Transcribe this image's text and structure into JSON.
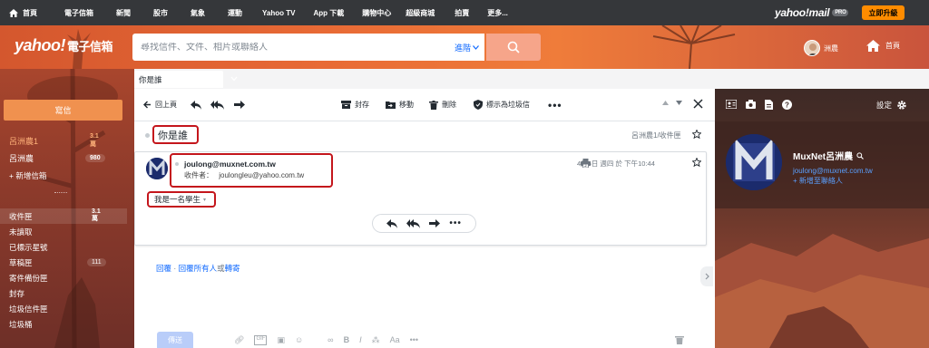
{
  "topnav": {
    "items": [
      "首頁",
      "電子信箱",
      "新聞",
      "股市",
      "氣象",
      "運動",
      "Yahoo TV",
      "App 下載",
      "購物中心",
      "超級商城",
      "拍賣",
      "更多..."
    ],
    "brand": "yahoo!mail",
    "pro_badge": "PRO",
    "upgrade_label": "立即升級"
  },
  "header": {
    "logo": "yahoo!",
    "logo_sub": "電子信箱",
    "search_placeholder": "尋找信件、文件、相片或聯絡人",
    "advanced_label": "進階",
    "user_name": "洲農",
    "home_label": "首頁"
  },
  "sidebar": {
    "compose_label": "寫信",
    "accounts": [
      {
        "name": "呂洲農1",
        "count": "3.1萬"
      },
      {
        "name": "呂洲農",
        "count": "980"
      }
    ],
    "add_mailbox": "+ 新增信箱",
    "folders": [
      {
        "name": "收件匣",
        "count": "3.1\n萬"
      },
      {
        "name": "未讀取",
        "count": ""
      },
      {
        "name": "已標示星號",
        "count": ""
      },
      {
        "name": "草稿匣",
        "count": "111"
      },
      {
        "name": "寄件備份匣",
        "count": ""
      },
      {
        "name": "封存",
        "count": ""
      },
      {
        "name": "垃圾信件匣",
        "count": ""
      },
      {
        "name": "垃圾桶",
        "count": ""
      }
    ]
  },
  "tab": {
    "label": "你是誰"
  },
  "toolbar": {
    "back_label": "回上頁",
    "archive_label": "封存",
    "move_label": "移動",
    "delete_label": "刪除",
    "spam_label": "標示為垃圾信"
  },
  "message": {
    "subject": "你是誰",
    "subject_meta": "呂洲農1/收件匣",
    "sender_email": "joulong@muxnet.com.tw",
    "to_label": "收件者：",
    "to_email": "joulongleu@yahoo.com.tw",
    "date": "4月6日 週四 於 下午10:44",
    "body": "我是一名學生",
    "body_caret": "▾"
  },
  "reply": {
    "reply": "回覆",
    "sep1": " · ",
    "reply_all": "回覆所有人",
    "or": "或",
    "forward": "轉寄",
    "send_label": "傳送"
  },
  "contact": {
    "settings_label": "設定",
    "name": "MuxNet呂洲農",
    "email": "joulong@muxnet.com.tw",
    "add_contact": "+ 新增至聯絡人"
  },
  "colors": {
    "nav_bg": "#35373a",
    "header_orange": "#e86a35",
    "accent_red": "#c4161c",
    "link_blue": "#0f69ff",
    "upgrade": "#ff8c00"
  }
}
